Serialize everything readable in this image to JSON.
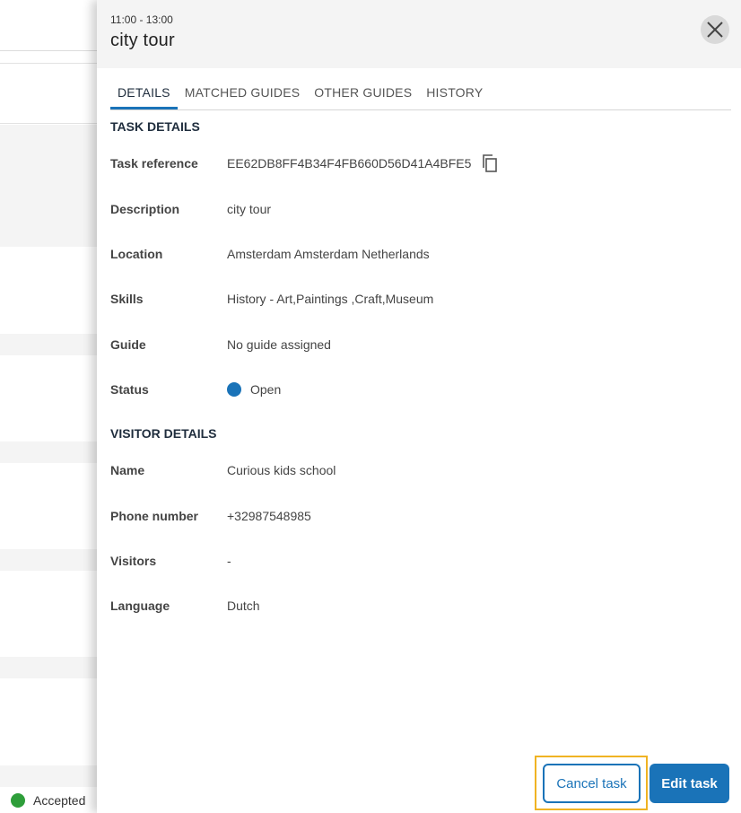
{
  "background": {
    "status_text": "Accepted"
  },
  "panel": {
    "time": "11:00 - 13:00",
    "title": "city tour",
    "close_icon": "close-icon",
    "tabs": [
      {
        "label": "DETAILS",
        "active": true
      },
      {
        "label": "MATCHED GUIDES",
        "active": false
      },
      {
        "label": "OTHER GUIDES",
        "active": false
      },
      {
        "label": "HISTORY",
        "active": false
      }
    ],
    "task_details": {
      "heading": "TASK DETAILS",
      "rows": [
        {
          "label": "Task reference",
          "value": "EE62DB8FF4B34F4FB660D56D41A4BFE5"
        },
        {
          "label": "Description",
          "value": "city tour"
        },
        {
          "label": "Location",
          "value": "Amsterdam Amsterdam Netherlands"
        },
        {
          "label": "Skills",
          "value": "History - Art,Paintings ,Craft,Museum"
        },
        {
          "label": "Guide",
          "value": "No guide assigned"
        },
        {
          "label": "Status",
          "value": "Open"
        }
      ]
    },
    "visitor_details": {
      "heading": "VISITOR DETAILS",
      "rows": [
        {
          "label": "Name",
          "value": "Curious kids school"
        },
        {
          "label": "Phone number",
          "value": "+32987548985"
        },
        {
          "label": "Visitors",
          "value": "-"
        },
        {
          "label": "Language",
          "value": "Dutch"
        }
      ]
    },
    "buttons": {
      "cancel_label": "Cancel task",
      "edit_label": "Edit task"
    }
  },
  "colors": {
    "accent": "#1a73b8",
    "focus_outline": "#f0b323",
    "status_open": "#1a73b8",
    "status_accepted": "#2e9e3a"
  }
}
